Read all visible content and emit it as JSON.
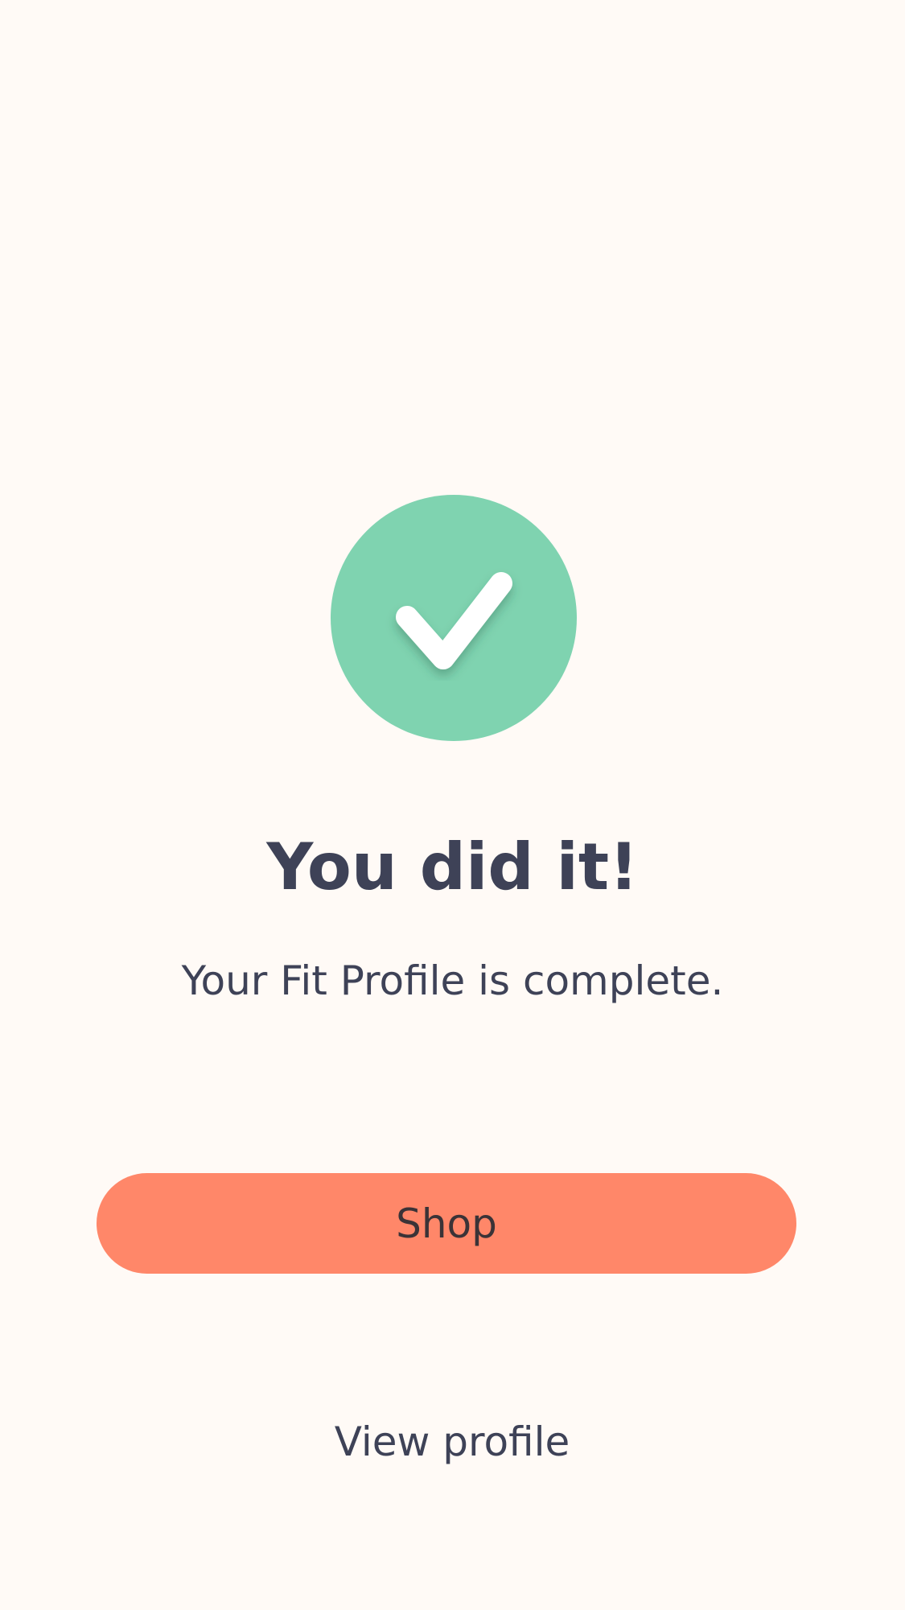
{
  "success_icon": {
    "icon": "checkmark-icon",
    "circle_color": "#7fd3b0",
    "check_color": "#ffffff"
  },
  "confirmation": {
    "title": "You did it!",
    "subtitle": "Your Fit Profile is complete."
  },
  "actions": {
    "shop_label": "Shop",
    "shop_color": "#ff8769",
    "view_profile_label": "View profile"
  },
  "theme": {
    "background": "#fffaf6",
    "text": "#3e4257"
  }
}
